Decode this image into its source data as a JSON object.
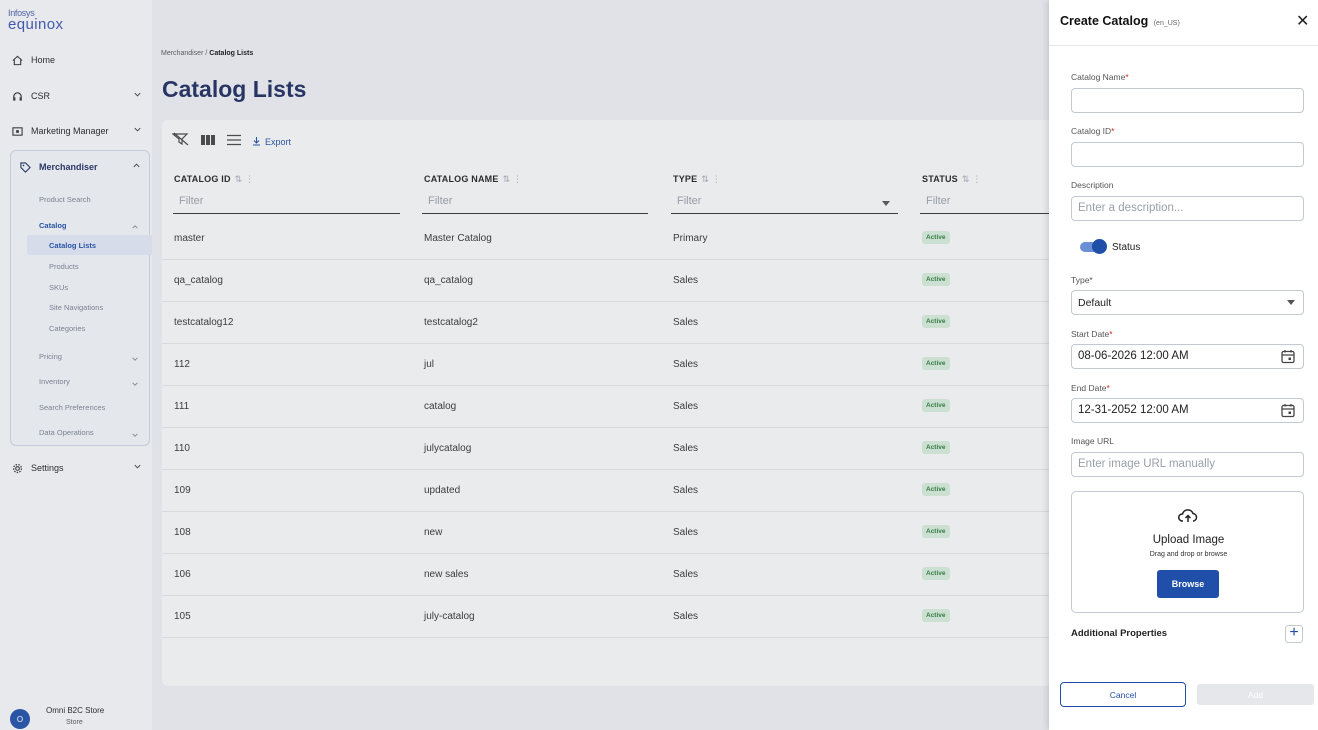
{
  "brand": {
    "small": "Infosys",
    "big": "equinox"
  },
  "sidebar": {
    "home": "Home",
    "csr": "CSR",
    "marketing": "Marketing Manager",
    "merchandiser": "Merchandiser",
    "merch_items": [
      "Product Search",
      "Catalog"
    ],
    "catalog_items": [
      "Catalog Lists",
      "Products",
      "SKUs",
      "Site Navigations",
      "Categories"
    ],
    "other_items": [
      "Pricing",
      "Inventory",
      "Search Preferences",
      "Data Operations"
    ],
    "settings": "Settings",
    "store_initial": "O",
    "store_name": "Omni B2C Store",
    "store_sub": "Store"
  },
  "breadcrumb": {
    "root": "Merchandiser",
    "sep": "/",
    "current": "Catalog Lists"
  },
  "page_title": "Catalog Lists",
  "toolbar": {
    "export": "Export"
  },
  "table": {
    "headers": [
      "CATALOG ID",
      "CATALOG NAME",
      "TYPE",
      "STATUS"
    ],
    "filter_placeholder": "Filter",
    "rows": [
      {
        "id": "master",
        "name": "Master Catalog",
        "type": "Primary",
        "status": "Active"
      },
      {
        "id": "qa_catalog",
        "name": "qa_catalog",
        "type": "Sales",
        "status": "Active"
      },
      {
        "id": "testcatalog12",
        "name": "testcatalog2",
        "type": "Sales",
        "status": "Active"
      },
      {
        "id": "112",
        "name": "jul",
        "type": "Sales",
        "status": "Active"
      },
      {
        "id": "111",
        "name": "catalog",
        "type": "Sales",
        "status": "Active"
      },
      {
        "id": "110",
        "name": "julycatalog",
        "type": "Sales",
        "status": "Active"
      },
      {
        "id": "109",
        "name": "updated",
        "type": "Sales",
        "status": "Active"
      },
      {
        "id": "108",
        "name": "new",
        "type": "Sales",
        "status": "Active"
      },
      {
        "id": "106",
        "name": "new sales",
        "type": "Sales",
        "status": "Active"
      },
      {
        "id": "105",
        "name": "july-catalog",
        "type": "Sales",
        "status": "Active"
      }
    ]
  },
  "drawer": {
    "title": "Create Catalog",
    "locale": "(en_US)",
    "catalog_name_label": "Catalog Name",
    "catalog_name_value": "",
    "catalog_id_label": "Catalog ID",
    "catalog_id_value": "",
    "description_label": "Description",
    "description_placeholder": "Enter a description...",
    "status_label": "Status",
    "status_on": true,
    "type_label": "Type*",
    "type_value": "Default",
    "start_date_label": "Start Date",
    "start_date_value": "08-06-2026 12:00 AM",
    "end_date_label": "End Date",
    "end_date_value": "12-31-2052 12:00 AM",
    "image_url_label": "Image URL",
    "image_url_placeholder": "Enter image URL manually",
    "upload_title": "Upload Image",
    "upload_sub": "Drag and drop or browse",
    "browse": "Browse",
    "additional_properties": "Additional Properties",
    "cancel": "Cancel",
    "add": "Add",
    "required_mark": "*"
  },
  "colors": {
    "accent": "#1f4fa8",
    "title": "#1d2b5e",
    "active_badge_bg": "#d6edd9",
    "active_badge_text": "#2f7a3e"
  }
}
